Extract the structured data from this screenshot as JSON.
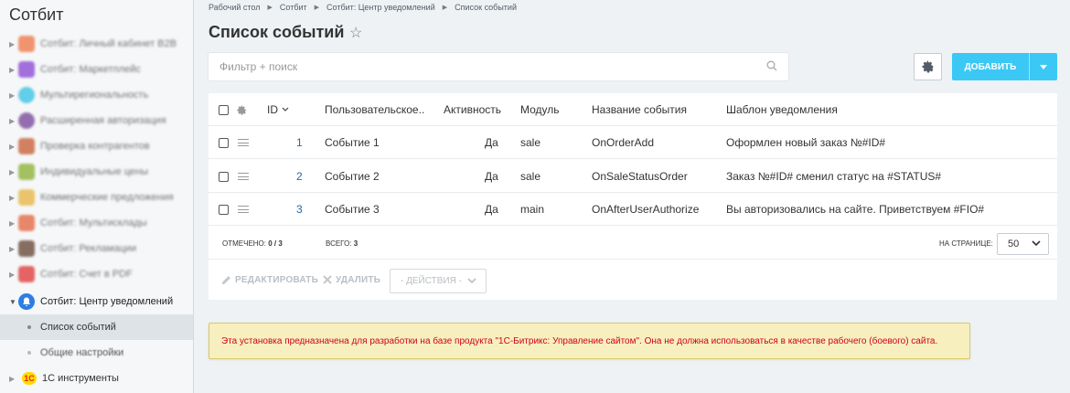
{
  "sidebar": {
    "title": "Сотбит",
    "items": [
      {
        "label": "Сотбит: Личный кабинет B2B",
        "color": "#f07c4d"
      },
      {
        "label": "Сотбит: Маркетплейс",
        "color": "#8d4fd6"
      },
      {
        "label": "Мультирегиональность",
        "color": "#3fc4e6"
      },
      {
        "label": "Расширенная авторизация",
        "color": "#7b4d9e"
      },
      {
        "label": "Проверка контрагентов",
        "color": "#c9643a"
      },
      {
        "label": "Индивидуальные цены",
        "color": "#8fb43c"
      },
      {
        "label": "Коммерческие предложения",
        "color": "#e8b84a"
      },
      {
        "label": "Сотбит: Мультисклады",
        "color": "#e56b46"
      },
      {
        "label": "Сотбит: Рекламации",
        "color": "#6a4c3b"
      },
      {
        "label": "Сотбит: Счет в PDF",
        "color": "#e04040"
      }
    ],
    "active_section": {
      "label": "Сотбит: Центр уведомлений",
      "color": "#2f7de1"
    },
    "sub_items": [
      {
        "label": "Список событий"
      },
      {
        "label": "Общие настройки"
      }
    ],
    "tools": {
      "label": "1С инструменты",
      "badge": "1С"
    }
  },
  "breadcrumb": [
    "Рабочий стол",
    "Сотбит",
    "Сотбит: Центр уведомлений",
    "Список событий"
  ],
  "page_title": "Список событий",
  "filter": {
    "placeholder": "Фильтр + поиск"
  },
  "add_button": {
    "label": "ДОБАВИТЬ"
  },
  "grid": {
    "columns": {
      "id": "ID",
      "user": "Пользовательское...",
      "active": "Активность",
      "module": "Модуль",
      "event": "Название события",
      "template": "Шаблон уведомления"
    },
    "rows": [
      {
        "id": "1",
        "user": "Событие 1",
        "active": "Да",
        "module": "sale",
        "event": "OnOrderAdd",
        "template": "Оформлен новый заказ №#ID#"
      },
      {
        "id": "2",
        "user": "Событие 2",
        "active": "Да",
        "module": "sale",
        "event": "OnSaleStatusOrder",
        "template": "Заказ №#ID# сменил статус на #STATUS#"
      },
      {
        "id": "3",
        "user": "Событие 3",
        "active": "Да",
        "module": "main",
        "event": "OnAfterUserAuthorize",
        "template": "Вы авторизовались на сайте. Приветствуем #FIO#"
      }
    ],
    "footer": {
      "selected_label": "ОТМЕЧЕНО:",
      "selected_value": "0 / 3",
      "total_label": "ВСЕГО:",
      "total_value": "3",
      "per_page_label": "НА СТРАНИЦЕ:",
      "per_page_value": "50"
    },
    "actions": {
      "edit": "РЕДАКТИРОВАТЬ",
      "delete": "УДАЛИТЬ",
      "select": "- ДЕЙСТВИЯ -"
    }
  },
  "warning": "Эта установка предназначена для разработки на базе продукта \"1С-Битрикс: Управление сайтом\". Она не должна использоваться в качестве рабочего (боевого) сайта."
}
